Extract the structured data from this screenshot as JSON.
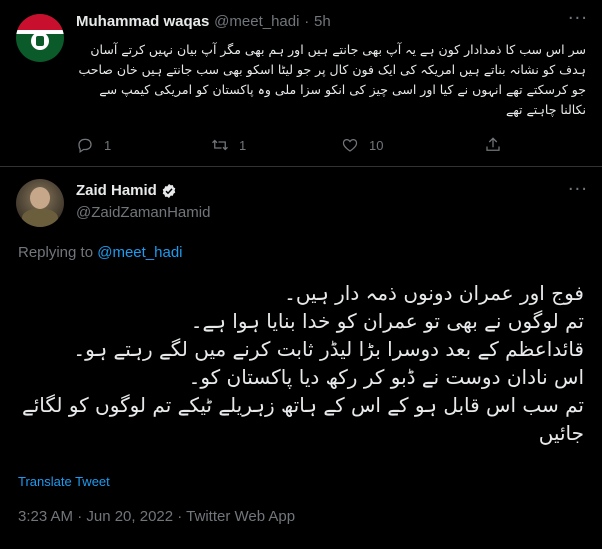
{
  "reply_tweet": {
    "name": "Muhammad waqas",
    "handle": "@meet_hadi",
    "separator": "·",
    "time": "5h",
    "more": "···",
    "body": "سر اس سب کا ذمدادار کون ہے یہ آپ بھی جانتے ہیں اور ہم بھی مگر آپ بیان نہیں کرتے آسان ہدف کو نشانہ بناتے ہیں امریکہ کی ایک فون کال پر جو لیٹا اسکو بھی سب جانتے ہیں خان صاحب جو کرسکتے تھے انہوں نے کیا اور اسی چیز کی انکو سزا ملی وہ پاکستان کو امریکی کیمپ سے نکالنا چاہتے تھے",
    "actions": {
      "reply_count": "1",
      "retweet_count": "1",
      "like_count": "10",
      "icons": [
        "reply-icon",
        "retweet-icon",
        "like-icon",
        "share-icon"
      ]
    }
  },
  "main_tweet": {
    "name": "Zaid Hamid",
    "handle": "@ZaidZamanHamid",
    "more": "···",
    "replying_prefix": "Replying to",
    "replying_mention": "@meet_hadi",
    "body_lines": [
      "فوج اور عمران دونوں ذمہ دار ہیں۔",
      "تم لوگوں نے بھی تو عمران کو خدا بنایا ہوا ہے۔",
      "قائداعظم کے بعد دوسرا بڑا لیڈر ثابت کرنے میں لگے رہتے ہو۔",
      "اس نادان دوست نے ڈبو کر رکھ دیا پاکستان کو۔",
      "تم سب اس قابل ہو کے اس کے ہاتھ زہریلے ٹیکے تم لوگوں کو لگائے جائیں"
    ],
    "translate": "Translate Tweet",
    "meta": "3:23 AM · Jun 20, 2022 · Twitter Web App"
  },
  "colors": {
    "background": "#000000",
    "text": "#e7e9ea",
    "muted": "#71767b",
    "accent": "#1d9bf0",
    "divider": "#2f3336"
  }
}
